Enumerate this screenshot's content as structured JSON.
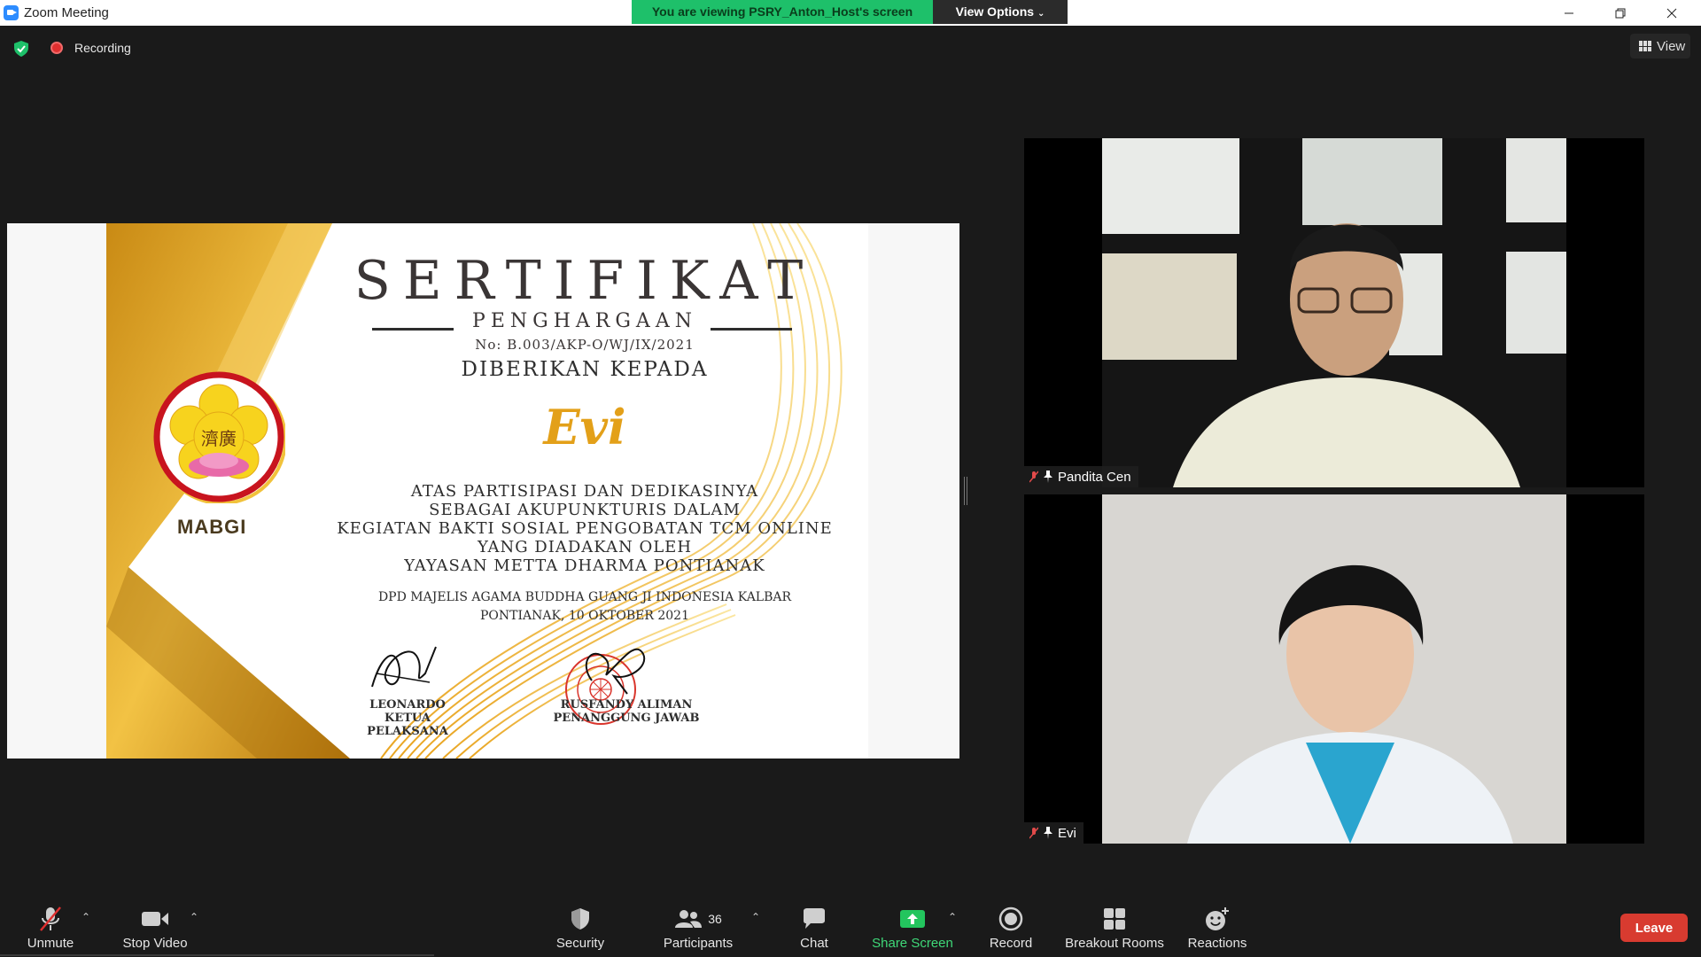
{
  "window": {
    "title": "Zoom Meeting"
  },
  "banner": {
    "viewing_text": "You are viewing PSRY_Anton_Host's screen",
    "view_options_label": "View Options"
  },
  "meeting_bar": {
    "recording_label": "Recording",
    "view_label": "View"
  },
  "certificate": {
    "title": "SERTIFIKAT",
    "subtitle": "PENGHARGAAN",
    "number": "No: B.003/AKP-O/WJ/IX/2021",
    "given_to": "DIBERIKAN KEPADA",
    "recipient": "Evi",
    "body_lines": [
      "ATAS PARTISIPASI DAN DEDIKASINYA",
      "SEBAGAI AKUPUNKTURIS DALAM",
      "KEGIATAN BAKTI SOSIAL PENGOBATAN TCM ONLINE",
      "YANG DIADAKAN OLEH",
      "YAYASAN METTA DHARMA PONTIANAK"
    ],
    "organization": "DPD MAJELIS AGAMA BUDDHA GUANG JI INDONESIA KALBAR",
    "place_date": "PONTIANAK, 10 OKTOBER 2021",
    "logo_text": "MABGI",
    "logo_glyphs": "濟廣",
    "signer_left": {
      "name": "LEONARDO",
      "role": "KETUA PELAKSANA"
    },
    "signer_right": {
      "name": "RUSFANDY ALIMAN",
      "role": "PENANGGUNG JAWAB"
    }
  },
  "participants": [
    {
      "name": "Pandita Cen"
    },
    {
      "name": "Evi"
    }
  ],
  "toolbar": {
    "unmute": "Unmute",
    "stop_video": "Stop Video",
    "security": "Security",
    "participants": "Participants",
    "participants_count": "36",
    "chat": "Chat",
    "share_screen": "Share Screen",
    "record": "Record",
    "breakout_rooms": "Breakout Rooms",
    "reactions": "Reactions",
    "leave": "Leave"
  },
  "colors": {
    "banner_green": "#1ec06a",
    "leave_red": "#d83b30",
    "share_green": "#23c55e",
    "gold": "#e3a019"
  }
}
